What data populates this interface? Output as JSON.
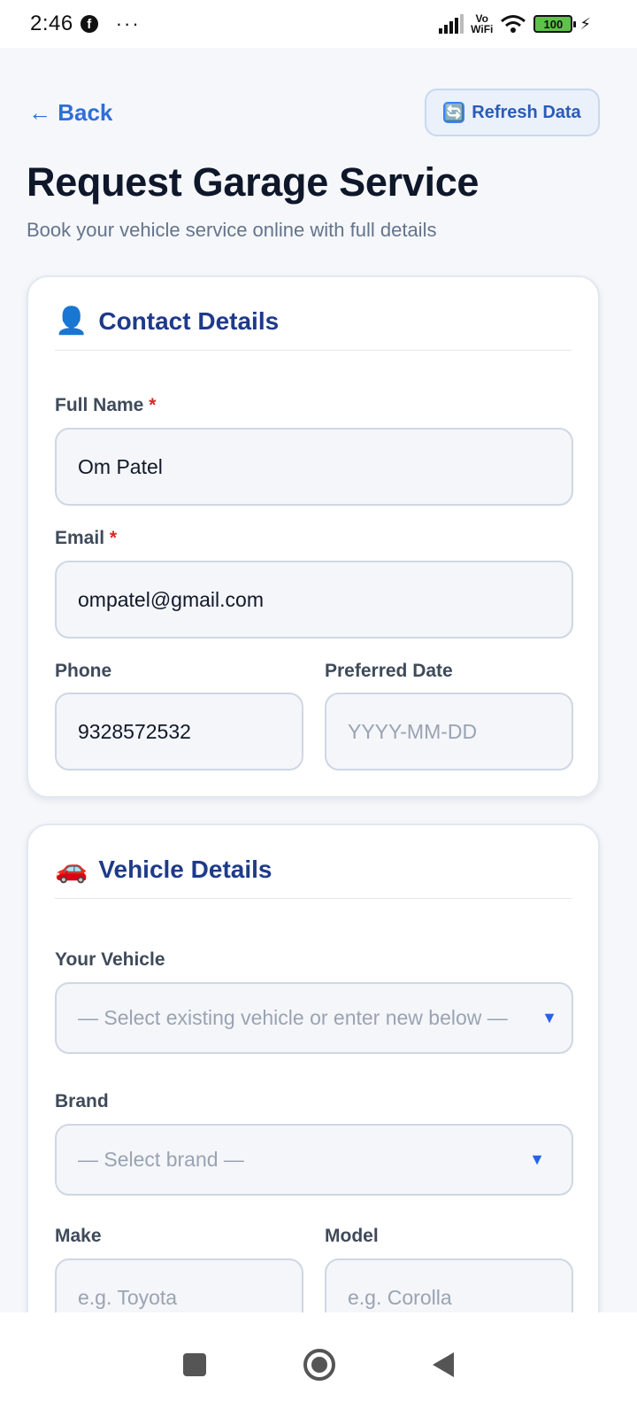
{
  "status_bar": {
    "time": "2:46",
    "vowifi_top": "Vo",
    "vowifi_bottom": "WiFi",
    "battery": "100"
  },
  "header": {
    "back_label": "← Back",
    "refresh_icon": "🔄",
    "refresh_label": "Refresh Data",
    "title": "Request Garage Service",
    "subtitle": "Book your vehicle service online with full details"
  },
  "contact": {
    "icon": "👤",
    "title": "Contact Details",
    "full_name_label": "Full Name",
    "full_name_value": "Om Patel",
    "email_label": "Email",
    "email_value": "ompatel@gmail.com",
    "phone_label": "Phone",
    "phone_value": "9328572532",
    "date_label": "Preferred Date",
    "date_placeholder": "YYYY-MM-DD",
    "required_mark": "*"
  },
  "vehicle": {
    "icon": "🚗",
    "title": "Vehicle Details",
    "your_vehicle_label": "Your Vehicle",
    "your_vehicle_placeholder": "— Select existing vehicle or enter new below —",
    "brand_label": "Brand",
    "brand_placeholder": "— Select brand —",
    "make_label": "Make",
    "make_placeholder": "e.g. Toyota",
    "model_label": "Model",
    "model_placeholder": "e.g. Corolla",
    "dropdown_caret": "▼"
  },
  "colors": {
    "accent": "#2f6fd6",
    "title": "#1e3a8a",
    "required": "#dc2626"
  }
}
